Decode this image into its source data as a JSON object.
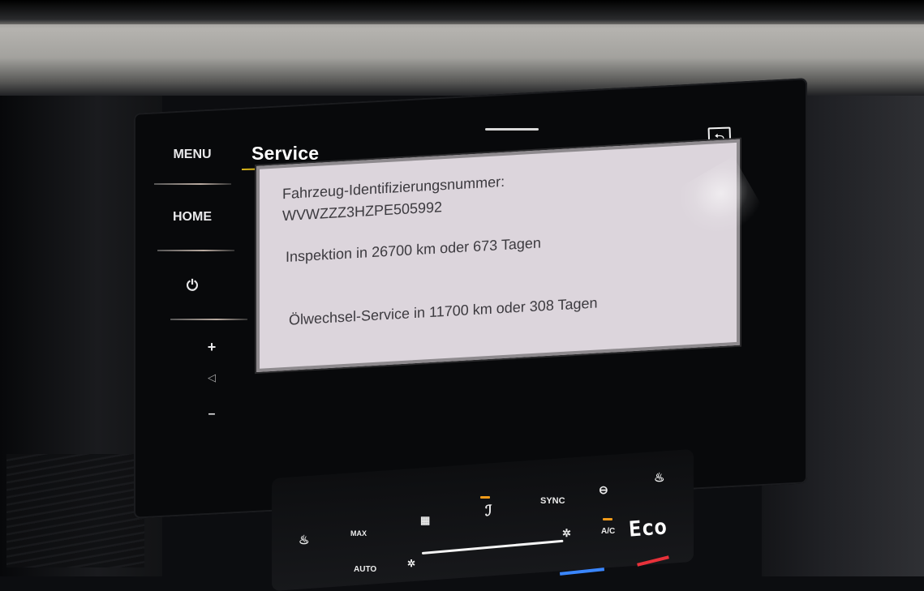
{
  "side_controls": {
    "menu_label": "MENU",
    "home_label": "HOME",
    "power_icon": "⏻",
    "volume_up": "+",
    "volume_icon": "◁",
    "volume_down": "–"
  },
  "screen": {
    "title": "Service",
    "back_icon": "⮌",
    "vin_label": "Fahrzeug-Identifizierungsnummer:",
    "vin_value": "WVWZZZ3HZPE505992",
    "inspection": "Inspektion in 26700 km oder 673 Tagen",
    "oil_service": "Ölwechsel-Service in 11700 km oder 308 Tagen"
  },
  "climate": {
    "sync_label": "SYNC",
    "ac_label": "A/C",
    "eco_label": "Eco",
    "max_label": "MAX",
    "auto_label": "AUTO",
    "accent_orange": "#f09a1a",
    "accent_blue": "#3a86ff",
    "accent_red": "#e8313a"
  },
  "colors": {
    "accent_line": "#d6b31a",
    "card_bg": "#dcd5dc"
  }
}
